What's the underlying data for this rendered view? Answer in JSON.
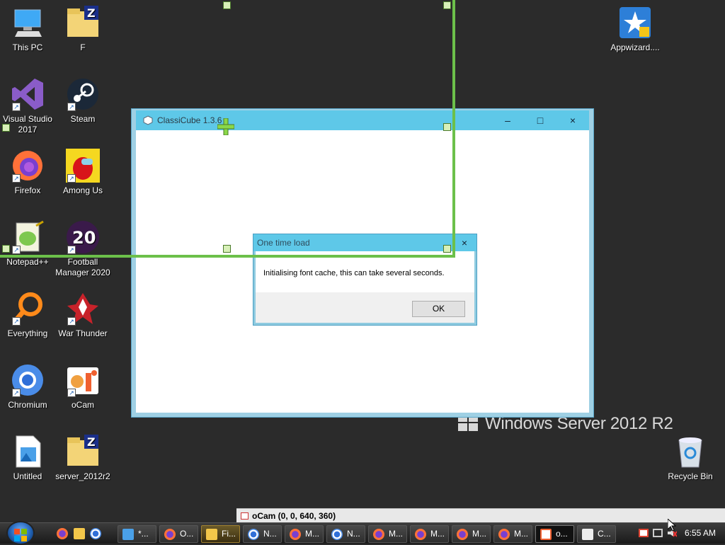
{
  "desktop_icons": [
    {
      "label": "This PC",
      "icon": "computer-icon"
    },
    {
      "label": "F",
      "icon": "zip-folder-icon"
    },
    {
      "label": "Appwizard....",
      "icon": "appwizard-icon"
    },
    {
      "label": "Visual Studio 2017",
      "icon": "visual-studio-icon"
    },
    {
      "label": "Steam",
      "icon": "steam-icon"
    },
    {
      "label": "Firefox",
      "icon": "firefox-icon"
    },
    {
      "label": "Among Us",
      "icon": "among-us-icon"
    },
    {
      "label": "Notepad++",
      "icon": "notepadpp-icon"
    },
    {
      "label": "Football Manager 2020",
      "icon": "football-manager-icon",
      "badge": "20"
    },
    {
      "label": "Everything",
      "icon": "everything-search-icon"
    },
    {
      "label": "War Thunder",
      "icon": "war-thunder-icon"
    },
    {
      "label": "Chromium",
      "icon": "chromium-icon"
    },
    {
      "label": "oCam",
      "icon": "ocam-icon"
    },
    {
      "label": "Untitled",
      "icon": "image-file-icon"
    },
    {
      "label": "server_2012r2",
      "icon": "zip-folder-icon"
    },
    {
      "label": "Recycle Bin",
      "icon": "recycle-bin-icon"
    }
  ],
  "main_window": {
    "title": "ClassiCube 1.3.6",
    "minimize": "–",
    "maximize": "□",
    "close": "×"
  },
  "dialog": {
    "title": "One time load",
    "close": "×",
    "message": "Initialising font cache, this can take several seconds.",
    "ok_label": "OK"
  },
  "watermark": "Windows Server 2012 R2",
  "ocam_bar": {
    "text": "oCam (0, 0, 640, 360)"
  },
  "taskbar": {
    "buttons": [
      {
        "label": "*...",
        "icon": "notepad-icon"
      },
      {
        "label": "O...",
        "icon": "firefox-icon"
      },
      {
        "label": "Fi...",
        "icon": "explorer-icon"
      },
      {
        "label": "N...",
        "icon": "chromium-icon"
      },
      {
        "label": "M...",
        "icon": "firefox-icon"
      },
      {
        "label": "N...",
        "icon": "chromium-icon"
      },
      {
        "label": "M...",
        "icon": "firefox-icon"
      },
      {
        "label": "M...",
        "icon": "firefox-icon"
      },
      {
        "label": "M...",
        "icon": "firefox-icon"
      },
      {
        "label": "M...",
        "icon": "firefox-icon"
      },
      {
        "label": "o...",
        "icon": "ocam-icon"
      },
      {
        "label": "C...",
        "icon": "classicube-icon"
      }
    ],
    "clock": "6:55 AM"
  },
  "colors": {
    "desktop": "#2b2b2b",
    "titlebar": "#5ec8e8",
    "capture_rect": "#6cc04a"
  }
}
